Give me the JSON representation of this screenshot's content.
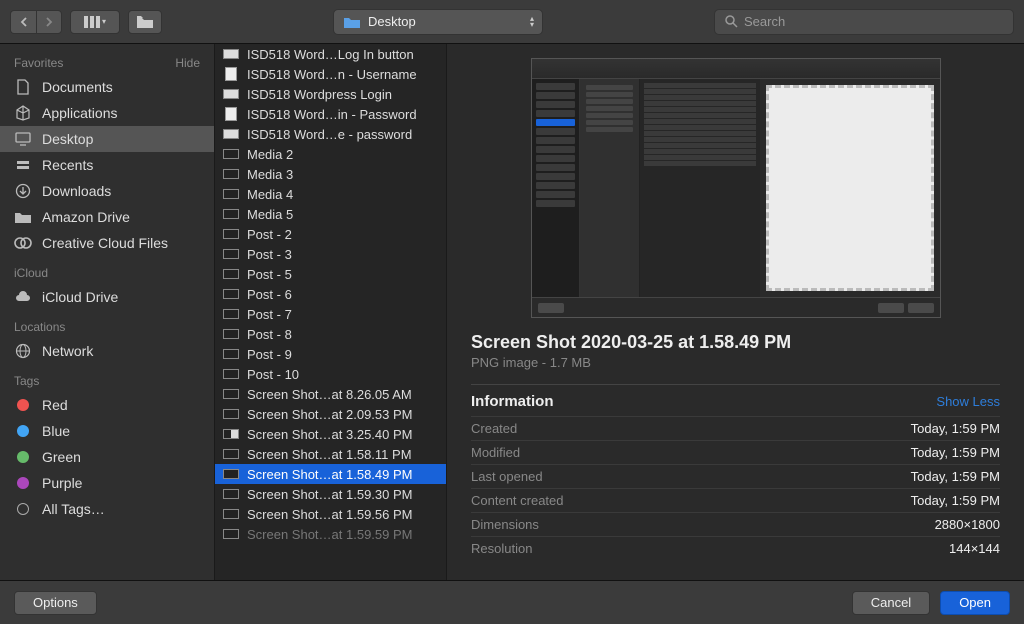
{
  "toolbar": {
    "path_label": "Desktop",
    "search_placeholder": "Search"
  },
  "sidebar": {
    "favorites_label": "Favorites",
    "hide_label": "Hide",
    "favorites": [
      {
        "label": "Documents",
        "icon": "document"
      },
      {
        "label": "Applications",
        "icon": "apps"
      },
      {
        "label": "Desktop",
        "icon": "desktop",
        "selected": true
      },
      {
        "label": "Recents",
        "icon": "recents"
      },
      {
        "label": "Downloads",
        "icon": "downloads"
      },
      {
        "label": "Amazon Drive",
        "icon": "folder"
      },
      {
        "label": "Creative Cloud Files",
        "icon": "cc"
      }
    ],
    "icloud_label": "iCloud",
    "icloud": [
      {
        "label": "iCloud Drive",
        "icon": "cloud"
      }
    ],
    "locations_label": "Locations",
    "locations": [
      {
        "label": "Network",
        "icon": "globe"
      }
    ],
    "tags_label": "Tags",
    "tags": [
      {
        "label": "Red",
        "color": "#ef5350"
      },
      {
        "label": "Blue",
        "color": "#42a5f5"
      },
      {
        "label": "Green",
        "color": "#66bb6a"
      },
      {
        "label": "Purple",
        "color": "#ab47bc"
      },
      {
        "label": "All Tags…",
        "color": null
      }
    ]
  },
  "files": [
    {
      "name": "ISD518 Word…Log In button",
      "type": "screenshot-light"
    },
    {
      "name": "ISD518 Word…n - Username",
      "type": "doc"
    },
    {
      "name": "ISD518 Wordpress Login",
      "type": "screenshot-light"
    },
    {
      "name": "ISD518 Word…in - Password",
      "type": "doc"
    },
    {
      "name": "ISD518 Word…e - password",
      "type": "screenshot-light"
    },
    {
      "name": "Media 2",
      "type": "screenshot-dark"
    },
    {
      "name": "Media 3",
      "type": "screenshot-dark"
    },
    {
      "name": "Media 4",
      "type": "screenshot-dark"
    },
    {
      "name": "Media 5",
      "type": "screenshot-dark"
    },
    {
      "name": "Post - 2",
      "type": "screenshot-dark"
    },
    {
      "name": "Post - 3",
      "type": "screenshot-dark"
    },
    {
      "name": "Post - 5",
      "type": "screenshot-dark"
    },
    {
      "name": "Post - 6",
      "type": "screenshot-dark"
    },
    {
      "name": "Post - 7",
      "type": "screenshot-dark"
    },
    {
      "name": "Post - 8",
      "type": "screenshot-dark"
    },
    {
      "name": "Post - 9",
      "type": "screenshot-dark"
    },
    {
      "name": "Post - 10",
      "type": "screenshot-dark"
    },
    {
      "name": "Screen Shot…at 8.26.05 AM",
      "type": "screenshot-dark"
    },
    {
      "name": "Screen Shot…at 2.09.53 PM",
      "type": "screenshot-dark"
    },
    {
      "name": "Screen Shot…at 3.25.40 PM",
      "type": "screenshot-split"
    },
    {
      "name": "Screen Shot…at 1.58.11 PM",
      "type": "screenshot-dark"
    },
    {
      "name": "Screen Shot…at 1.58.49 PM",
      "type": "screenshot-dark",
      "selected": true
    },
    {
      "name": "Screen Shot…at 1.59.30 PM",
      "type": "screenshot-dark"
    },
    {
      "name": "Screen Shot…at 1.59.56 PM",
      "type": "screenshot-dark"
    },
    {
      "name": "Screen Shot…at 1.59.59 PM",
      "type": "screenshot-dark",
      "dim": true
    }
  ],
  "preview": {
    "title": "Screen Shot 2020-03-25 at 1.58.49 PM",
    "subtitle": "PNG image - 1.7 MB",
    "info_header": "Information",
    "show_less": "Show Less",
    "rows": [
      {
        "label": "Created",
        "value": "Today, 1:59 PM"
      },
      {
        "label": "Modified",
        "value": "Today, 1:59 PM"
      },
      {
        "label": "Last opened",
        "value": "Today, 1:59 PM"
      },
      {
        "label": "Content created",
        "value": "Today, 1:59 PM"
      },
      {
        "label": "Dimensions",
        "value": "2880×1800"
      },
      {
        "label": "Resolution",
        "value": "144×144"
      }
    ]
  },
  "footer": {
    "options": "Options",
    "cancel": "Cancel",
    "open": "Open"
  }
}
